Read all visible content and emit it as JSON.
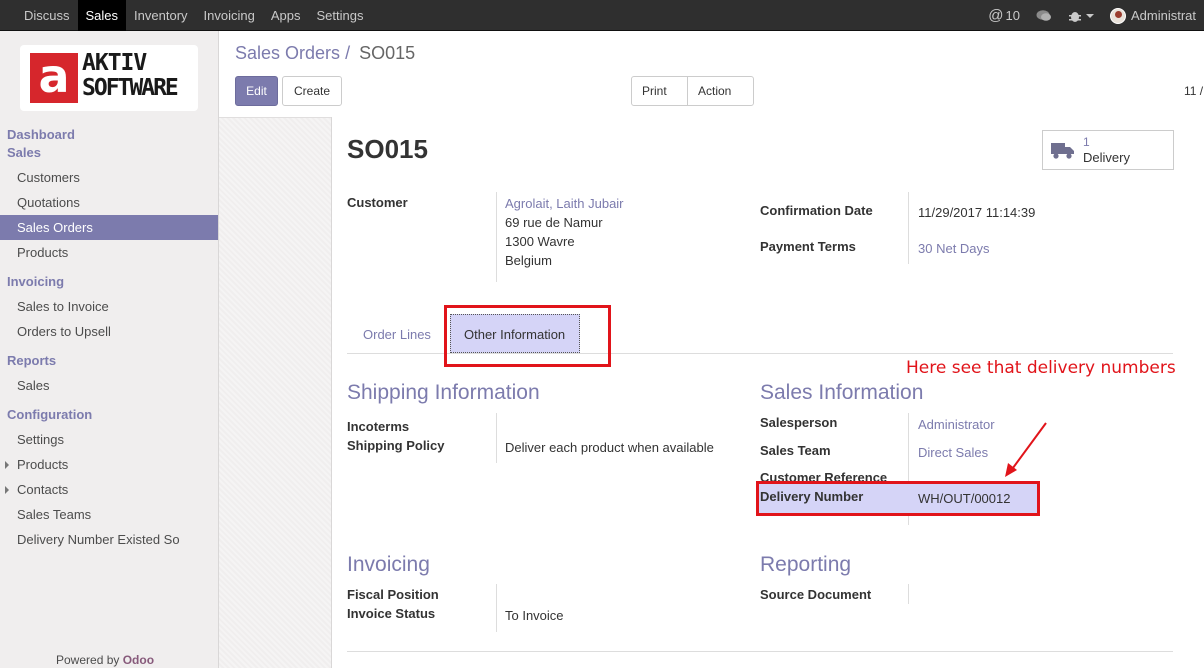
{
  "topbar": {
    "menu": [
      "Discuss",
      "Sales",
      "Inventory",
      "Invoicing",
      "Apps",
      "Settings"
    ],
    "active": "Sales",
    "messages_count": "10",
    "user": "Administrat"
  },
  "sidebar": {
    "logo_top": "AKTIV",
    "logo_bottom": "SOFTWARE",
    "logo_letter": "a",
    "dashboard": "Dashboard",
    "sales_header": "Sales",
    "sales_items": [
      "Customers",
      "Quotations",
      "Sales Orders",
      "Products"
    ],
    "invoicing_header": "Invoicing",
    "invoicing_items": [
      "Sales to Invoice",
      "Orders to Upsell"
    ],
    "reports_header": "Reports",
    "reports_items": [
      "Sales"
    ],
    "configuration_header": "Configuration",
    "configuration_items": [
      "Settings",
      "Products",
      "Contacts",
      "Sales Teams",
      "Delivery Number Existed So"
    ],
    "powered_by": "Powered by",
    "powered_brand": "Odoo"
  },
  "control_panel": {
    "breadcrumb_parent": "Sales Orders",
    "breadcrumb_sep": "/",
    "breadcrumb_current": "SO015",
    "edit_label": "Edit",
    "create_label": "Create",
    "print_label": "Print",
    "action_label": "Action",
    "pager": "11 /"
  },
  "form": {
    "title": "SO015",
    "delivery_count": "1",
    "delivery_label": "Delivery",
    "customer_label": "Customer",
    "customer_name": "Agrolait, Laith Jubair",
    "customer_address": [
      "69 rue de Namur",
      "1300 Wavre",
      "Belgium"
    ],
    "confirmation_date_label": "Confirmation Date",
    "confirmation_date": "11/29/2017 11:14:39",
    "payment_terms_label": "Payment Terms",
    "payment_terms": "30 Net Days",
    "tabs": [
      "Order Lines",
      "Other Information"
    ],
    "shipping_header": "Shipping Information",
    "incoterms_label": "Incoterms",
    "shipping_policy_label": "Shipping Policy",
    "shipping_policy": "Deliver each product when available",
    "sales_info_header": "Sales Information",
    "salesperson_label": "Salesperson",
    "salesperson": "Administrator",
    "sales_team_label": "Sales Team",
    "sales_team": "Direct Sales",
    "customer_ref_label": "Customer Reference",
    "delivery_number_label": "Delivery Number",
    "delivery_number": "WH/OUT/00012",
    "invoicing_header": "Invoicing",
    "fiscal_position_label": "Fiscal Position",
    "invoice_status_label": "Invoice Status",
    "invoice_status": "To Invoice",
    "reporting_header": "Reporting",
    "source_document_label": "Source Document"
  },
  "annotation": {
    "note": "Here see that delivery numbers",
    "color": "#e1141a"
  }
}
